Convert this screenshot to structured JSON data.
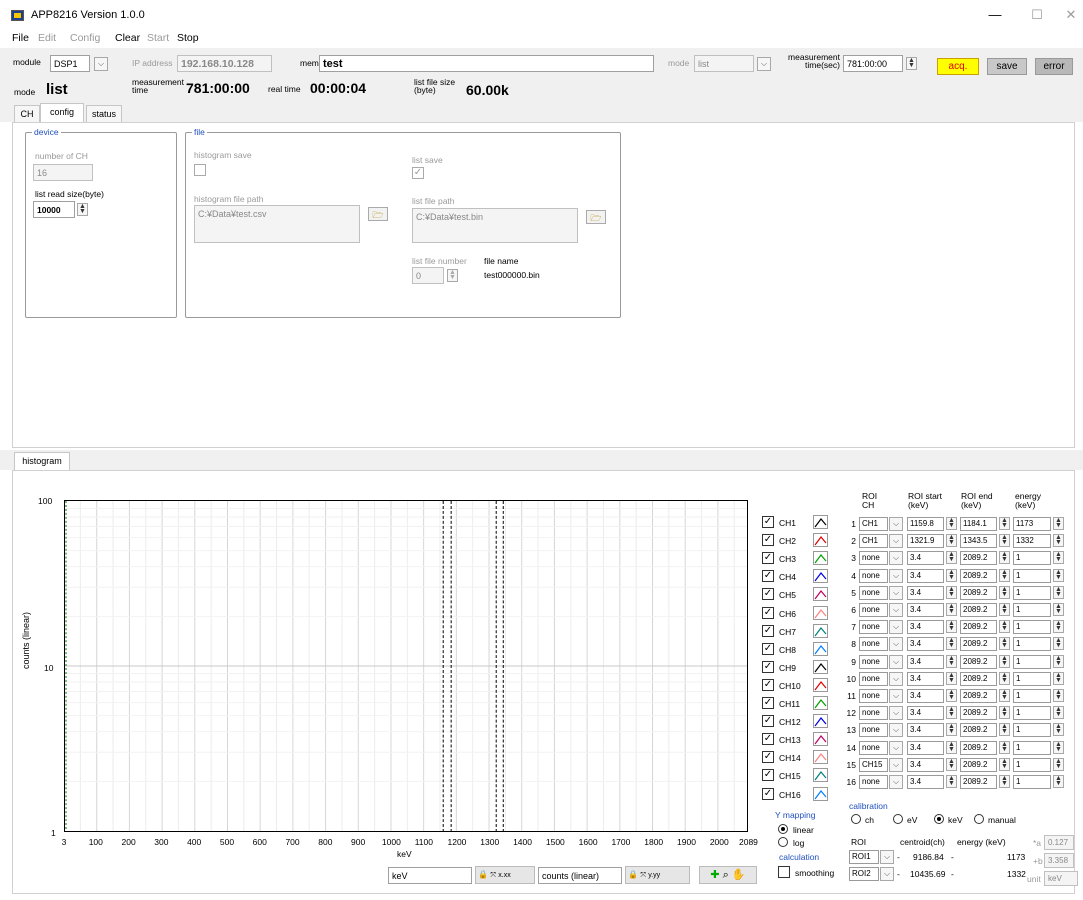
{
  "window": {
    "title": "APP8216  Version 1.0.0",
    "min": "—",
    "max": "☐",
    "close": "✕"
  },
  "menu": [
    {
      "label": "File",
      "enabled": true
    },
    {
      "label": "Edit",
      "enabled": false
    },
    {
      "label": "Config",
      "enabled": false
    },
    {
      "label": "Clear",
      "enabled": true
    },
    {
      "label": "Start",
      "enabled": false
    },
    {
      "label": "Stop",
      "enabled": true
    }
  ],
  "toolbar": {
    "module_label": "module",
    "module_value": "DSP1",
    "ip_label": "IP address",
    "ip_value": "192.168.10.128",
    "memo_label": "memo",
    "memo_value": "test",
    "mode_label": "mode",
    "mode_value": "list",
    "mtime_label": "measurement time(sec)",
    "mtime_value": "781:00:00",
    "acq_label": "acq.",
    "save_label": "save",
    "error_label": "error",
    "mode_big_label": "mode",
    "mode_big_value": "list",
    "meas_time_label": "measurement time",
    "meas_time_value": "781:00:00",
    "real_time_label": "real time",
    "real_time_value": "00:00:04",
    "file_size_label": "list file size (byte)",
    "file_size_value": "60.00k"
  },
  "tabs": [
    "CH",
    "config",
    "status"
  ],
  "device": {
    "title": "device",
    "num_ch_label": "number of CH",
    "num_ch_value": "16",
    "read_size_label": "list read size(byte)",
    "read_size_value": "10000"
  },
  "file": {
    "title": "file",
    "hist_save_label": "histogram save",
    "list_save_label": "list save",
    "hist_path_label": "histogram file path",
    "hist_path_value": "C:¥Data¥test.csv",
    "list_path_label": "list file path",
    "list_path_value": "C:¥Data¥test.bin",
    "list_num_label": "list file number",
    "list_num_value": "0",
    "fname_label": "file name",
    "fname_value": "test000000.bin"
  },
  "hist_tab": "histogram",
  "plot": {
    "ylabel": "counts (linear)",
    "xlabel": "keV",
    "y_ticks": [
      "100",
      "10",
      "1"
    ],
    "x_ticks": [
      "3",
      "100",
      "200",
      "300",
      "400",
      "500",
      "600",
      "700",
      "800",
      "900",
      "1000",
      "1100",
      "1200",
      "1300",
      "1400",
      "1500",
      "1600",
      "1700",
      "1800",
      "1900",
      "2000",
      "2089"
    ],
    "x_min": 3,
    "x_max": 2089,
    "x_axis_label": "keV",
    "y_axis_label": "counts (linear)",
    "markers": [
      1159.8,
      1184.1,
      1321.9,
      1343.5
    ]
  },
  "channels": [
    {
      "name": "CH1",
      "color": "#000000"
    },
    {
      "name": "CH2",
      "color": "#e00000"
    },
    {
      "name": "CH3",
      "color": "#00a000"
    },
    {
      "name": "CH4",
      "color": "#0000e0"
    },
    {
      "name": "CH5",
      "color": "#c00060"
    },
    {
      "name": "CH6",
      "color": "#ff8080"
    },
    {
      "name": "CH7",
      "color": "#008080"
    },
    {
      "name": "CH8",
      "color": "#0080ff"
    },
    {
      "name": "CH9",
      "color": "#000000"
    },
    {
      "name": "CH10",
      "color": "#e00000"
    },
    {
      "name": "CH11",
      "color": "#00a000"
    },
    {
      "name": "CH12",
      "color": "#0000e0"
    },
    {
      "name": "CH13",
      "color": "#c00060"
    },
    {
      "name": "CH14",
      "color": "#ff8080"
    },
    {
      "name": "CH15",
      "color": "#008080"
    },
    {
      "name": "CH16",
      "color": "#0080ff"
    }
  ],
  "roi_headers": {
    "roi": "ROI",
    "ch": "CH",
    "start": "ROI start",
    "start_unit": "(keV)",
    "end": "ROI end",
    "end_unit": "(keV)",
    "energy": "energy",
    "energy_unit": "(keV)"
  },
  "roi_rows": [
    {
      "n": "1",
      "ch": "CH1",
      "start": "1159.8",
      "end": "1184.1",
      "energy": "1173"
    },
    {
      "n": "2",
      "ch": "CH1",
      "start": "1321.9",
      "end": "1343.5",
      "energy": "1332"
    },
    {
      "n": "3",
      "ch": "none",
      "start": "3.4",
      "end": "2089.2",
      "energy": "1"
    },
    {
      "n": "4",
      "ch": "none",
      "start": "3.4",
      "end": "2089.2",
      "energy": "1"
    },
    {
      "n": "5",
      "ch": "none",
      "start": "3.4",
      "end": "2089.2",
      "energy": "1"
    },
    {
      "n": "6",
      "ch": "none",
      "start": "3.4",
      "end": "2089.2",
      "energy": "1"
    },
    {
      "n": "7",
      "ch": "none",
      "start": "3.4",
      "end": "2089.2",
      "energy": "1"
    },
    {
      "n": "8",
      "ch": "none",
      "start": "3.4",
      "end": "2089.2",
      "energy": "1"
    },
    {
      "n": "9",
      "ch": "none",
      "start": "3.4",
      "end": "2089.2",
      "energy": "1"
    },
    {
      "n": "10",
      "ch": "none",
      "start": "3.4",
      "end": "2089.2",
      "energy": "1"
    },
    {
      "n": "11",
      "ch": "none",
      "start": "3.4",
      "end": "2089.2",
      "energy": "1"
    },
    {
      "n": "12",
      "ch": "none",
      "start": "3.4",
      "end": "2089.2",
      "energy": "1"
    },
    {
      "n": "13",
      "ch": "none",
      "start": "3.4",
      "end": "2089.2",
      "energy": "1"
    },
    {
      "n": "14",
      "ch": "none",
      "start": "3.4",
      "end": "2089.2",
      "energy": "1"
    },
    {
      "n": "15",
      "ch": "CH15",
      "start": "3.4",
      "end": "2089.2",
      "energy": "1"
    },
    {
      "n": "16",
      "ch": "none",
      "start": "3.4",
      "end": "2089.2",
      "energy": "1"
    }
  ],
  "ymap": {
    "title": "Y mapping",
    "linear": "linear",
    "log": "log"
  },
  "calc": {
    "title": "calculation",
    "smoothing": "smoothing"
  },
  "calib": {
    "title": "calibration",
    "opts": [
      "ch",
      "eV",
      "keV",
      "manual"
    ],
    "selected": "keV",
    "roi_label": "ROI",
    "centroid_label": "centroid(ch)",
    "energy_label": "energy (keV)",
    "rows": [
      {
        "roi": "ROI1",
        "centroid": "9186.84",
        "energy": "1173"
      },
      {
        "roi": "ROI2",
        "centroid": "10435.69",
        "energy": "1332"
      }
    ],
    "a_label": "*a",
    "a_value": "0.127",
    "b_label": "+b",
    "b_value": "3.358",
    "unit_label": "unit",
    "unit_value": "keV"
  }
}
